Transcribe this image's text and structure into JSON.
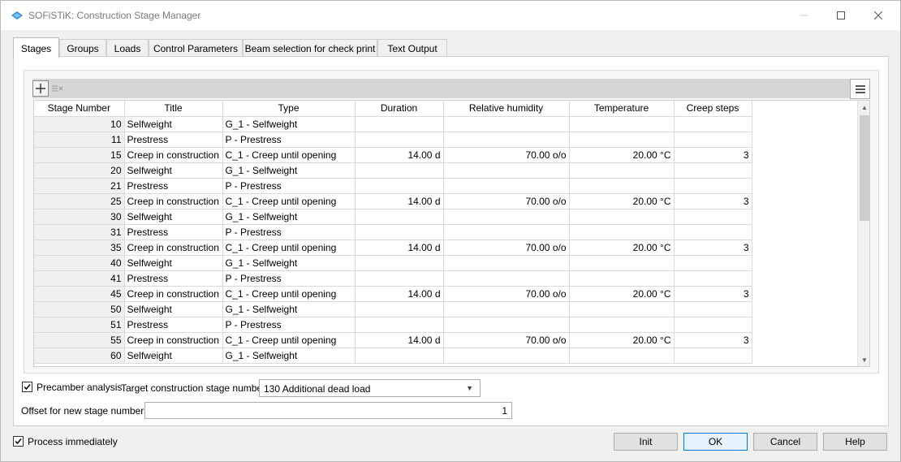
{
  "window": {
    "title": "SOFiSTiK: Construction Stage Manager"
  },
  "tabs": [
    {
      "label": "Stages",
      "active": true
    },
    {
      "label": "Groups"
    },
    {
      "label": "Loads"
    },
    {
      "label": "Control Parameters"
    },
    {
      "label": "Beam selection for check print"
    },
    {
      "label": "Text Output"
    }
  ],
  "toolbar": {
    "add_icon": "plus-icon",
    "delete_icon": "delete-rows-icon",
    "menu_icon": "hamburger-menu-icon"
  },
  "table": {
    "columns": [
      "Stage Number",
      "Title",
      "Type",
      "Duration",
      "Relative humidity",
      "Temperature",
      "Creep steps"
    ],
    "rows": [
      {
        "stage": "10",
        "title": "Selfweight",
        "type": "G_1  - Selfweight",
        "duration": "",
        "humidity": "",
        "temperature": "",
        "creep": ""
      },
      {
        "stage": "11",
        "title": "Prestress",
        "type": "P    - Prestress",
        "duration": "",
        "humidity": "",
        "temperature": "",
        "creep": ""
      },
      {
        "stage": "15",
        "title": "Creep in construction",
        "type": "C_1  - Creep until opening",
        "duration": "14.00 d",
        "humidity": "70.00 o/o",
        "temperature": "20.00 °C",
        "creep": "3"
      },
      {
        "stage": "20",
        "title": "Selfweight",
        "type": "G_1  - Selfweight",
        "duration": "",
        "humidity": "",
        "temperature": "",
        "creep": ""
      },
      {
        "stage": "21",
        "title": "Prestress",
        "type": "P    - Prestress",
        "duration": "",
        "humidity": "",
        "temperature": "",
        "creep": ""
      },
      {
        "stage": "25",
        "title": "Creep in construction",
        "type": "C_1  - Creep until opening",
        "duration": "14.00 d",
        "humidity": "70.00 o/o",
        "temperature": "20.00 °C",
        "creep": "3"
      },
      {
        "stage": "30",
        "title": "Selfweight",
        "type": "G_1  - Selfweight",
        "duration": "",
        "humidity": "",
        "temperature": "",
        "creep": ""
      },
      {
        "stage": "31",
        "title": "Prestress",
        "type": "P    - Prestress",
        "duration": "",
        "humidity": "",
        "temperature": "",
        "creep": ""
      },
      {
        "stage": "35",
        "title": "Creep in construction",
        "type": "C_1  - Creep until opening",
        "duration": "14.00 d",
        "humidity": "70.00 o/o",
        "temperature": "20.00 °C",
        "creep": "3"
      },
      {
        "stage": "40",
        "title": "Selfweight",
        "type": "G_1  - Selfweight",
        "duration": "",
        "humidity": "",
        "temperature": "",
        "creep": ""
      },
      {
        "stage": "41",
        "title": "Prestress",
        "type": "P    - Prestress",
        "duration": "",
        "humidity": "",
        "temperature": "",
        "creep": ""
      },
      {
        "stage": "45",
        "title": "Creep in construction",
        "type": "C_1  - Creep until opening",
        "duration": "14.00 d",
        "humidity": "70.00 o/o",
        "temperature": "20.00 °C",
        "creep": "3"
      },
      {
        "stage": "50",
        "title": "Selfweight",
        "type": "G_1  - Selfweight",
        "duration": "",
        "humidity": "",
        "temperature": "",
        "creep": ""
      },
      {
        "stage": "51",
        "title": "Prestress",
        "type": "P    - Prestress",
        "duration": "",
        "humidity": "",
        "temperature": "",
        "creep": ""
      },
      {
        "stage": "55",
        "title": "Creep in construction",
        "type": "C_1  - Creep until opening",
        "duration": "14.00 d",
        "humidity": "70.00 o/o",
        "temperature": "20.00 °C",
        "creep": "3"
      },
      {
        "stage": "60",
        "title": "Selfweight",
        "type": "G_1  - Selfweight",
        "duration": "",
        "humidity": "",
        "temperature": "",
        "creep": ""
      }
    ]
  },
  "options": {
    "precamber_label": "Precamber analysis",
    "precamber_checked": true,
    "target_label": "Target construction stage number",
    "target_value": "130 Additional dead load",
    "offset_label": "Offset for new stage numbers",
    "offset_value": "1",
    "process_label": "Process immediately",
    "process_checked": true
  },
  "buttons": {
    "init": "Init",
    "ok": "OK",
    "cancel": "Cancel",
    "help": "Help"
  },
  "colors": {
    "accent": "#0078d7",
    "app_icon": "#2e8bd3"
  }
}
